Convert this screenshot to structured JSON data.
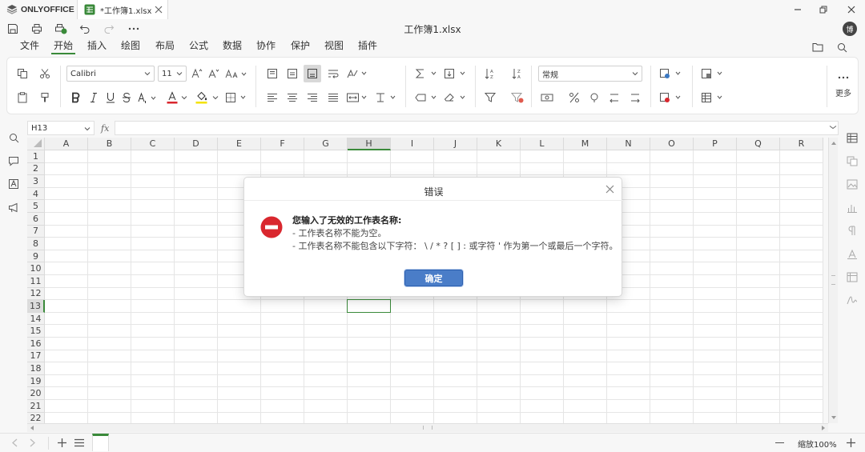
{
  "app": {
    "brand": "ONLYOFFICE",
    "doc_tab": "*工作簿1.xlsx",
    "doc_title": "工作簿1.xlsx",
    "avatar": "博"
  },
  "menu": [
    "文件",
    "开始",
    "插入",
    "绘图",
    "布局",
    "公式",
    "数据",
    "协作",
    "保护",
    "视图",
    "插件"
  ],
  "active_menu": "开始",
  "toolbar": {
    "font_name": "Calibri",
    "font_size": "11",
    "number_format": "常规",
    "more_label": "更多"
  },
  "formula_bar": {
    "name_box": "H13",
    "fx": "fx",
    "formula": ""
  },
  "grid": {
    "columns": [
      "A",
      "B",
      "C",
      "D",
      "E",
      "F",
      "G",
      "H",
      "I",
      "J",
      "K",
      "L",
      "M",
      "N",
      "O",
      "P",
      "Q",
      "R"
    ],
    "rows": [
      "1",
      "2",
      "3",
      "4",
      "5",
      "6",
      "7",
      "8",
      "9",
      "10",
      "11",
      "12",
      "13",
      "14",
      "15",
      "16",
      "17",
      "18",
      "19",
      "20",
      "21",
      "22"
    ],
    "selected_cell": "H13"
  },
  "status": {
    "zoom": "缩放100%"
  },
  "dialog": {
    "title": "错误",
    "heading": "您输入了无效的工作表名称:",
    "line1": "- 工作表名称不能为空。",
    "line2": "- 工作表名称不能包含以下字符： \\ / * ? [ ] : 或字符 ' 作为第一个或最后一个字符。",
    "ok": "确定"
  },
  "colors": {
    "accent": "#3a8a3a",
    "button": "#4a7dc8",
    "error": "#d9272e"
  }
}
